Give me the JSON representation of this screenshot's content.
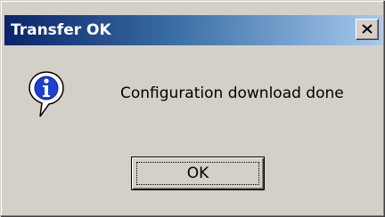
{
  "window": {
    "title": "Transfer OK",
    "close_icon": "close-icon",
    "title_gradient_start": "#0a246a",
    "title_gradient_end": "#a6caf0",
    "background": "#d4d0c8"
  },
  "dialog": {
    "icon": "info-icon",
    "message": "Configuration download done",
    "ok_label": "OK"
  }
}
